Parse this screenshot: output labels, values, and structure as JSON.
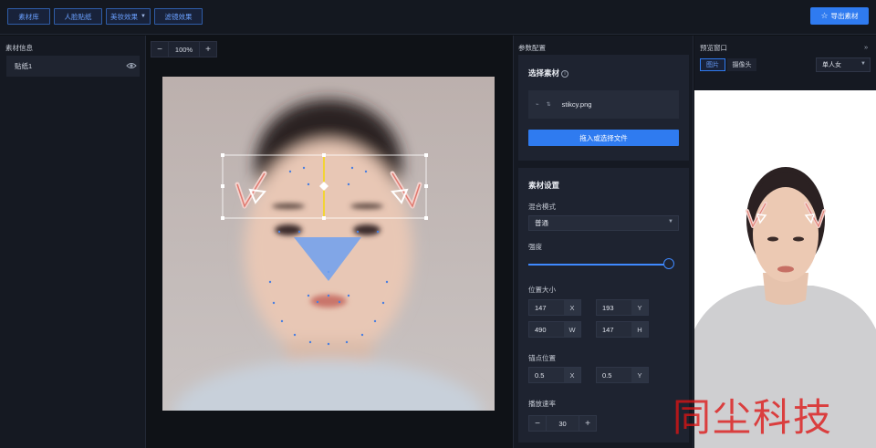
{
  "toolbar": {
    "library": "素材库",
    "face_sticker": "人脸贴纸",
    "beauty": "美妆效果",
    "filter": "滤镜效果",
    "export": "导出素材"
  },
  "left_panel": {
    "title": "素材信息",
    "layers": [
      "贴纸1"
    ]
  },
  "canvas": {
    "zoom": "100%",
    "minus": "−",
    "plus": "+"
  },
  "params": {
    "title": "参数配置",
    "select_material": {
      "heading": "选择素材",
      "file_name": "stikcy.png",
      "upload": "拖入或选择文件"
    },
    "material_settings": {
      "heading": "素材设置",
      "blend_label": "混合模式",
      "blend_value": "普通",
      "intensity_label": "强度",
      "intensity": 1.0,
      "position_label": "位置大小",
      "x": "147",
      "x_unit": "X",
      "y": "193",
      "y_unit": "Y",
      "w": "490",
      "w_unit": "W",
      "h": "147",
      "h_unit": "H",
      "anchor_label": "锚点位置",
      "ax": "0.5",
      "ax_unit": "X",
      "ay": "0.5",
      "ay_unit": "Y",
      "rate_label": "播放速率",
      "rate": "30",
      "minus": "−",
      "plus": "+"
    }
  },
  "preview": {
    "title": "预览窗口",
    "collapse": "»",
    "tab_image": "图片",
    "tab_camera": "摄像头",
    "person_select": "单人女"
  },
  "watermark": "同尘科技",
  "colors": {
    "accent": "#2f7bf0",
    "background": "#0f1217",
    "panel": "#151922",
    "guide_yellow": "#f5d90a"
  }
}
